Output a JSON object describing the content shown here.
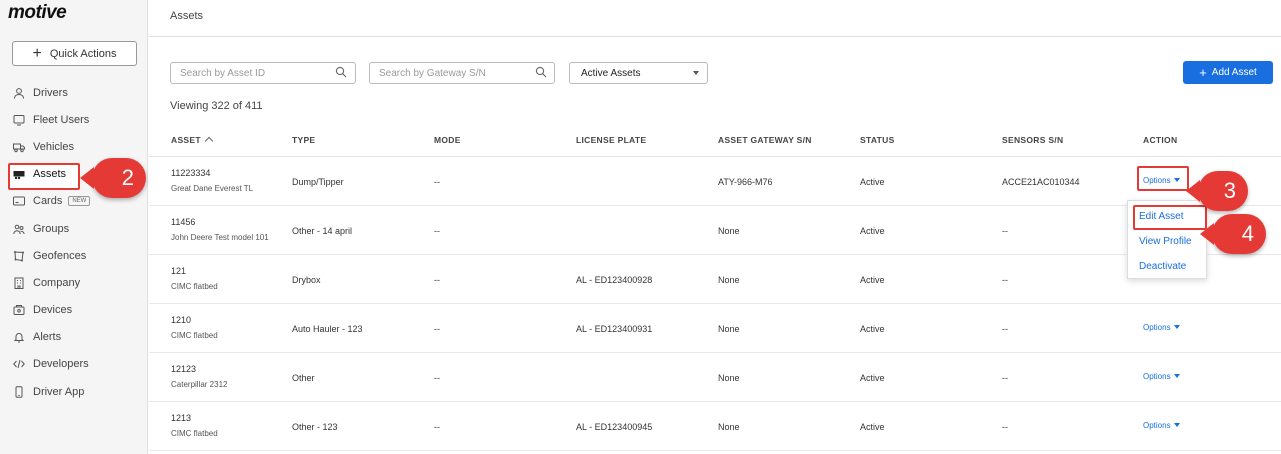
{
  "app": {
    "logo": "motive"
  },
  "sidebar": {
    "quick_actions": "Quick Actions",
    "items": [
      {
        "label": "Drivers",
        "icon": "person-icon"
      },
      {
        "label": "Fleet Users",
        "icon": "monitor-icon"
      },
      {
        "label": "Vehicles",
        "icon": "truck-icon"
      },
      {
        "label": "Assets",
        "icon": "trailer-icon",
        "active": true
      },
      {
        "label": "Cards",
        "icon": "card-icon",
        "badge": "NEW"
      },
      {
        "label": "Groups",
        "icon": "groups-icon"
      },
      {
        "label": "Geofences",
        "icon": "geofence-icon"
      },
      {
        "label": "Company",
        "icon": "building-icon"
      },
      {
        "label": "Devices",
        "icon": "devices-icon"
      },
      {
        "label": "Alerts",
        "icon": "bell-icon"
      },
      {
        "label": "Developers",
        "icon": "code-icon"
      },
      {
        "label": "Driver App",
        "icon": "phone-icon"
      }
    ]
  },
  "header": {
    "breadcrumb": "Assets"
  },
  "filters": {
    "asset_search_placeholder": "Search by Asset ID",
    "gateway_search_placeholder": "Search by Gateway S/N",
    "status_select": "Active Assets",
    "add_button": "Add Asset"
  },
  "viewing": "Viewing 322 of 411",
  "table": {
    "columns": [
      "ASSET",
      "TYPE",
      "MODE",
      "LICENSE PLATE",
      "ASSET GATEWAY S/N",
      "STATUS",
      "SENSORS S/N",
      "ACTION"
    ],
    "rows": [
      {
        "id": "11223334",
        "name": "Great Dane Everest TL",
        "type": "Dump/Tipper",
        "mode": "--",
        "plate": "",
        "gateway": "ATY-966-M76",
        "status": "Active",
        "sensors": "ACCE21AC010344",
        "action": "Options"
      },
      {
        "id": "11456",
        "name": "John Deere Test model 101",
        "type": "Other - 14 april",
        "mode": "--",
        "plate": "",
        "gateway": "None",
        "status": "Active",
        "sensors": "--",
        "action": ""
      },
      {
        "id": "121",
        "name": "CIMC flatbed",
        "type": "Drybox",
        "mode": "--",
        "plate": "AL - ED123400928",
        "gateway": "None",
        "status": "Active",
        "sensors": "--",
        "action": ""
      },
      {
        "id": "1210",
        "name": "CIMC flatbed",
        "type": "Auto Hauler - 123",
        "mode": "--",
        "plate": "AL - ED123400931",
        "gateway": "None",
        "status": "Active",
        "sensors": "--",
        "action": "Options"
      },
      {
        "id": "12123",
        "name": "Caterpillar 2312",
        "type": "Other",
        "mode": "--",
        "plate": "",
        "gateway": "None",
        "status": "Active",
        "sensors": "--",
        "action": "Options"
      },
      {
        "id": "1213",
        "name": "CIMC flatbed",
        "type": "Other - 123",
        "mode": "--",
        "plate": "AL - ED123400945",
        "gateway": "None",
        "status": "Active",
        "sensors": "--",
        "action": "Options"
      }
    ]
  },
  "dropdown": {
    "items": [
      "Edit Asset",
      "View Profile",
      "Deactivate"
    ]
  },
  "callouts": [
    "2",
    "3",
    "4"
  ],
  "colors": {
    "accent": "#1a6fe0",
    "highlight": "#e53935"
  }
}
